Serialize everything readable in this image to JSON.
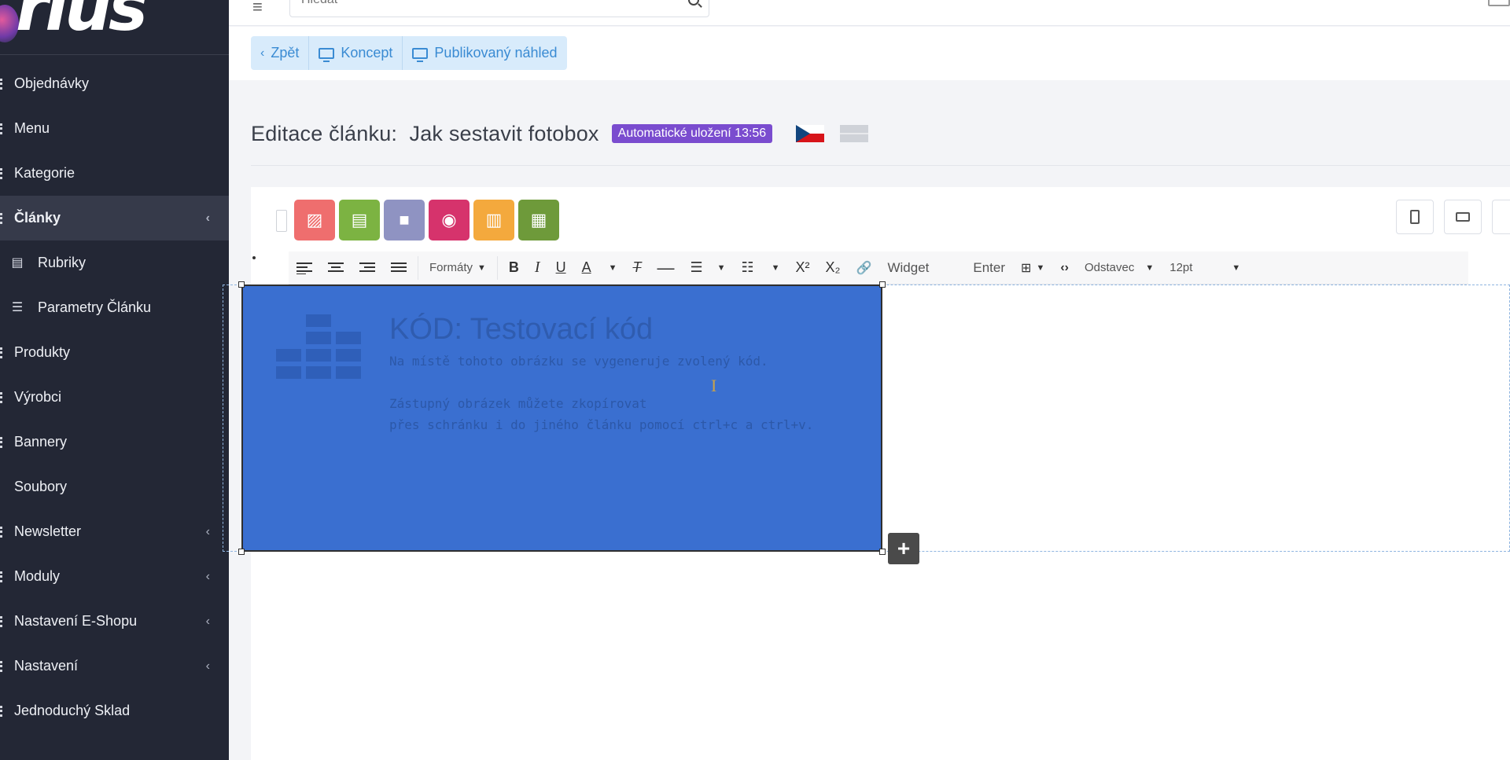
{
  "sidebar": {
    "items": [
      {
        "label": "Objednávky",
        "has_chevron": false,
        "icon": "bullet"
      },
      {
        "label": "Menu",
        "has_chevron": false,
        "icon": "bullet"
      },
      {
        "label": "Kategorie",
        "has_chevron": false,
        "icon": "bullet"
      },
      {
        "label": "Články",
        "has_chevron": true,
        "active": true,
        "icon": "bullet"
      },
      {
        "label": "Rubriky",
        "has_chevron": false,
        "sub": true,
        "icon": "newspaper-icon"
      },
      {
        "label": "Parametry Článku",
        "has_chevron": false,
        "sub": true,
        "icon": "sliders-icon"
      },
      {
        "label": "Produkty",
        "has_chevron": false,
        "icon": "bullet"
      },
      {
        "label": "Výrobci",
        "has_chevron": false,
        "icon": "bullet"
      },
      {
        "label": "Bannery",
        "has_chevron": false,
        "icon": "bullet"
      },
      {
        "label": "Soubory",
        "has_chevron": false,
        "icon": "none"
      },
      {
        "label": "Newsletter",
        "has_chevron": true,
        "icon": "bullet"
      },
      {
        "label": "Moduly",
        "has_chevron": true,
        "icon": "bullet"
      },
      {
        "label": "Nastavení E-Shopu",
        "has_chevron": true,
        "icon": "bullet"
      },
      {
        "label": "Nastavení",
        "has_chevron": true,
        "icon": "bullet"
      },
      {
        "label": "Jednoduchý Sklad",
        "has_chevron": false,
        "icon": "bullet"
      }
    ]
  },
  "topbar": {
    "search_placeholder": "Hledat"
  },
  "actions": {
    "back": "Zpět",
    "draft": "Koncept",
    "preview": "Publikovaný náhled"
  },
  "page": {
    "title_prefix": "Editace článku:",
    "title": "Jak sestavit fotobox",
    "autosave": "Automatické uložení 13:56"
  },
  "widgets": [
    {
      "name": "image-widget-button",
      "color": "#ef6e6e",
      "icon": "image-icon"
    },
    {
      "name": "file-widget-button",
      "color": "#7cb342",
      "icon": "file-icon"
    },
    {
      "name": "video-widget-button",
      "color": "#8f93c2",
      "icon": "video-icon"
    },
    {
      "name": "gallery-widget-button",
      "color": "#d6336c",
      "icon": "camera-icon"
    },
    {
      "name": "chart-widget-button",
      "color": "#f4a93d",
      "icon": "chart-icon"
    },
    {
      "name": "code-widget-button",
      "color": "#6e9a3a",
      "icon": "code-block-icon"
    }
  ],
  "toolbar": {
    "formats": "Formáty",
    "widget": "Widget",
    "enter": "Enter",
    "paragraph": "Odstavec",
    "font_size": "12pt"
  },
  "code_block": {
    "title": "KÓD: Testovací kód",
    "line1": "Na místě tohoto obrázku se vygeneruje zvolený kód.",
    "line2": "Zástupný obrázek můžete zkopírovat",
    "line3": "přes schránku i do jiného článku pomocí ctrl+c a ctrl+v.",
    "bg_color": "#3a6fd0"
  }
}
